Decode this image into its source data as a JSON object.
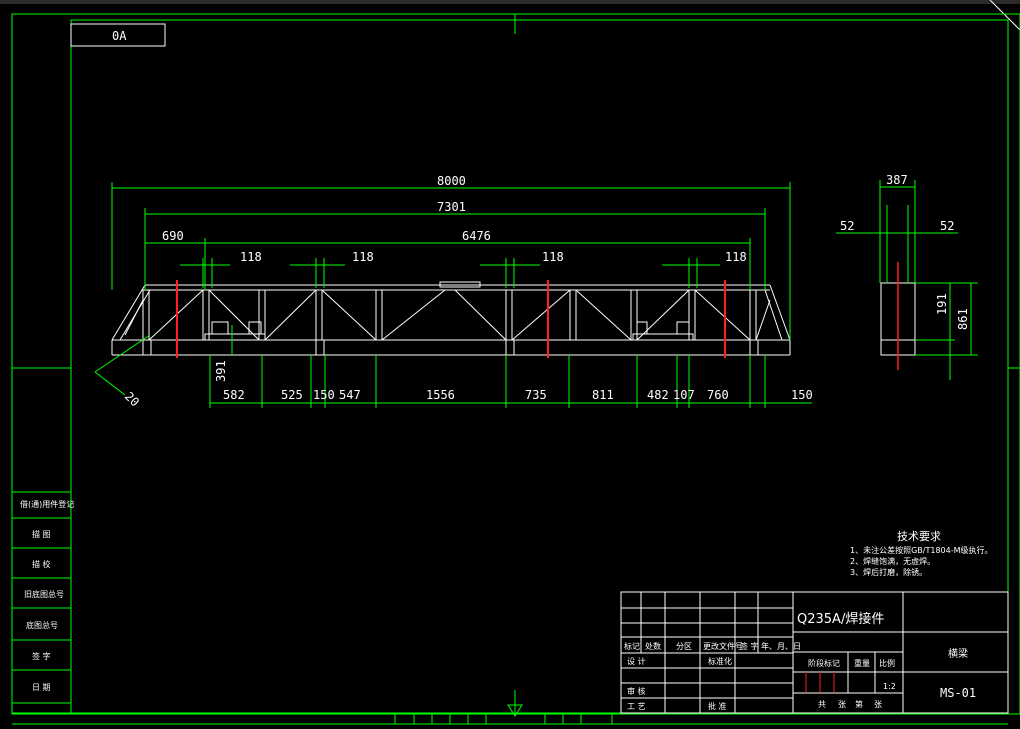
{
  "title_box": "0A",
  "dimensions": {
    "overall_length": "8000",
    "inner_length": "7301",
    "left_offset": "690",
    "span": "6476",
    "panel_width_1": "118",
    "panel_width_2": "118",
    "panel_width_3": "118",
    "panel_width_4": "118",
    "height_left": "391",
    "bevel": "20",
    "bottom_segments": [
      "582",
      "525",
      "150",
      "547",
      "1556",
      "735",
      "811",
      "482",
      "107",
      "760",
      "150"
    ],
    "side_width": "387",
    "side_left": "52",
    "side_right": "52",
    "side_h1": "191",
    "side_h2": "861"
  },
  "tech_requirements": {
    "heading": "技术要求",
    "items": [
      "1、未注公差按照GB/T1804-M级执行。",
      "2、焊缝饱满，无虚焊。",
      "3、焊后打磨，除锈。"
    ]
  },
  "left_stamps": [
    "借(通)用件登记",
    "描 图",
    "描 校",
    "旧底图总号",
    "底图总号",
    "签 字",
    "日 期"
  ],
  "title_block": {
    "material": "Q235A/焊接件",
    "part_name": "横梁",
    "drawing_no": "MS-01",
    "scale": "1:2",
    "row_headers": [
      "标记",
      "处数",
      "分区",
      "更改文件号",
      "签 字",
      "年、月、日"
    ],
    "labels_left": [
      "设 计",
      "标准化",
      "审 核",
      "工 艺",
      "批 准"
    ],
    "stage_labels": [
      "阶段标记",
      "重量",
      "比例"
    ],
    "footer": [
      "共",
      "张",
      "第",
      "张"
    ]
  }
}
